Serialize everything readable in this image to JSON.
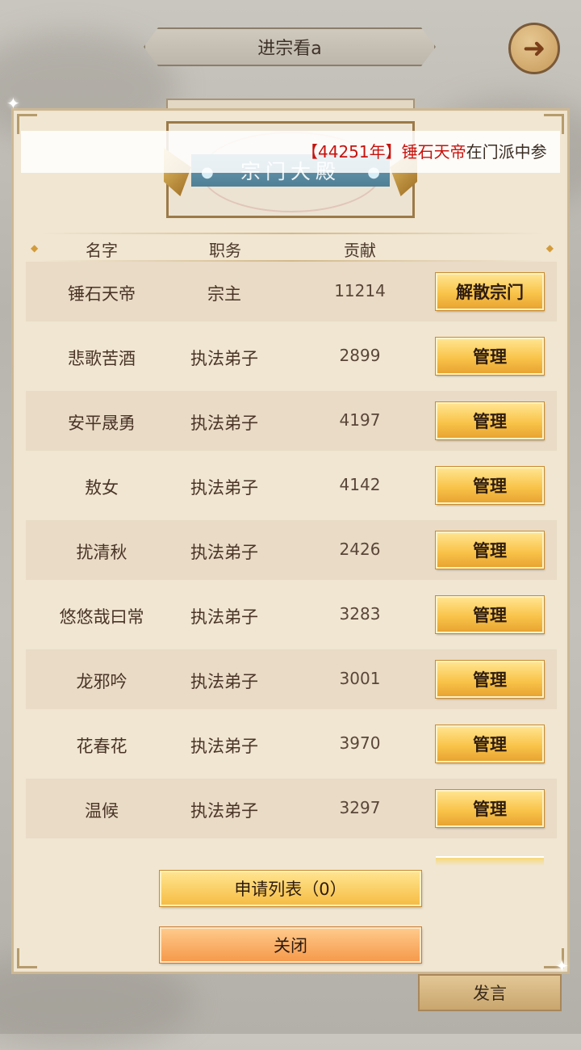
{
  "header": {
    "title": "进宗看a",
    "back_icon": "back-arrow-icon"
  },
  "banner": {
    "title": "宗门大殿"
  },
  "marquee": {
    "bracket_open": "【",
    "year": "44251年",
    "bracket_close": "】",
    "name": "锤石天帝",
    "text": "在门派中参"
  },
  "table": {
    "columns": [
      "名字",
      "职务",
      "贡献"
    ],
    "rows": [
      {
        "name": "锤石天帝",
        "role": "宗主",
        "contribution": "11214",
        "action": "解散宗门"
      },
      {
        "name": "悲歌苦酒",
        "role": "执法弟子",
        "contribution": "2899",
        "action": "管理"
      },
      {
        "name": "安平晟勇",
        "role": "执法弟子",
        "contribution": "4197",
        "action": "管理"
      },
      {
        "name": "敖女",
        "role": "执法弟子",
        "contribution": "4142",
        "action": "管理"
      },
      {
        "name": "扰清秋",
        "role": "执法弟子",
        "contribution": "2426",
        "action": "管理"
      },
      {
        "name": "悠悠哉曰常",
        "role": "执法弟子",
        "contribution": "3283",
        "action": "管理"
      },
      {
        "name": "龙邪吟",
        "role": "执法弟子",
        "contribution": "3001",
        "action": "管理"
      },
      {
        "name": "花春花",
        "role": "执法弟子",
        "contribution": "3970",
        "action": "管理"
      },
      {
        "name": "温候",
        "role": "执法弟子",
        "contribution": "3297",
        "action": "管理"
      }
    ]
  },
  "buttons": {
    "apply": "申请列表（0）",
    "close": "关闭",
    "speak": "发言"
  },
  "colors": {
    "accent_gold": "#f9c44a",
    "highlight_red": "#c8120d",
    "panel": "#f0e6d2"
  }
}
